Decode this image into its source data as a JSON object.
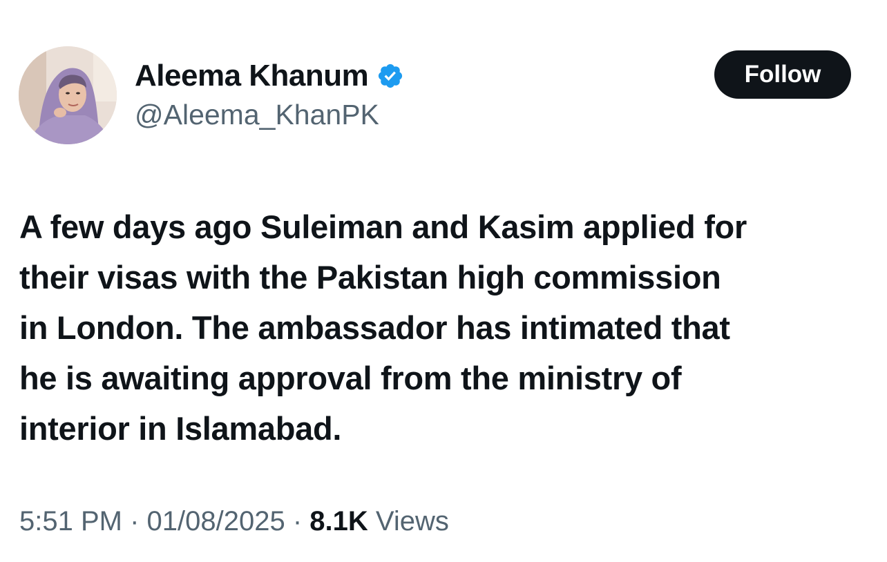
{
  "author": {
    "display_name": "Aleema Khanum",
    "handle": "@Aleema_KhanPK",
    "verified": true
  },
  "follow_button": {
    "label": "Follow"
  },
  "tweet": {
    "lines": [
      "A few days ago Suleiman and Kasim applied for",
      "their visas with the Pakistan high commission",
      "in London. The ambassador has intimated that",
      "he is awaiting approval from the ministry of",
      "interior in Islamabad."
    ]
  },
  "meta": {
    "time": "5:51 PM",
    "separator": " · ",
    "date": "01/08/2025",
    "views_count": "8.1K",
    "views_label": "Views"
  },
  "colors": {
    "text": "#0f1419",
    "secondary": "#536471",
    "verified_badge": "#1d9bf0",
    "follow_bg": "#0f1419"
  },
  "icons": {
    "verified": "verified-badge-icon"
  }
}
